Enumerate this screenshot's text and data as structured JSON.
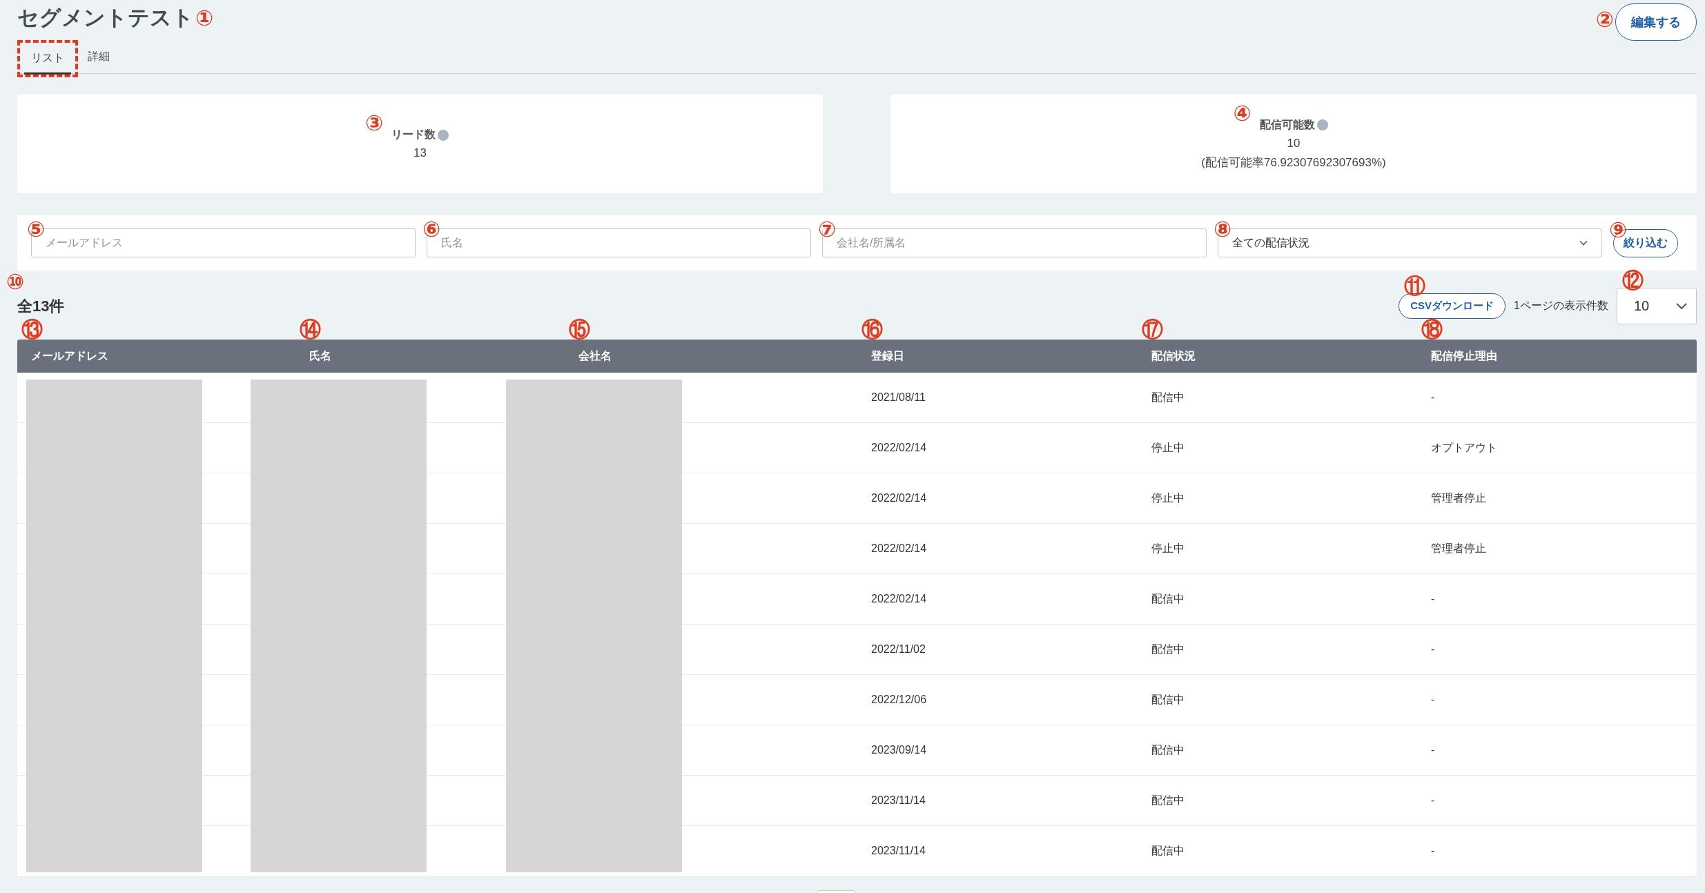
{
  "header": {
    "title": "セグメントテスト",
    "title_callout": "①",
    "edit_button": {
      "label": "編集する",
      "callout": "②"
    }
  },
  "tabs": [
    {
      "label": "リスト",
      "selected": true,
      "highlighted": true
    },
    {
      "label": "詳細",
      "selected": false,
      "highlighted": false
    }
  ],
  "stats": [
    {
      "label": "リード数",
      "value": "13",
      "callout": "③"
    },
    {
      "label": "配信可能数",
      "value": "10",
      "note": "(配信可能率76.92307692307693%)",
      "callout": "④"
    }
  ],
  "filters": {
    "fields": [
      {
        "kind": "text",
        "placeholder": "メールアドレス",
        "callout": "⑤"
      },
      {
        "kind": "text",
        "placeholder": "氏名",
        "callout": "⑥"
      },
      {
        "kind": "text",
        "placeholder": "会社名/所属名",
        "callout": "⑦"
      },
      {
        "kind": "select",
        "value": "全ての配信状況",
        "callout": "⑧"
      }
    ],
    "button": {
      "label": "絞り込む",
      "callout": "⑨"
    }
  },
  "results": {
    "total": "全13件",
    "total_callout": "⑩",
    "csv_button": {
      "label": "CSVダウンロード",
      "callout": "⑪"
    },
    "per_page_label": "1ページの表示件数",
    "per_page": {
      "value": "10",
      "callout": "⑫"
    }
  },
  "table": {
    "columns": [
      {
        "label": "メールアドレス",
        "callout": "⑬",
        "redacted": true
      },
      {
        "label": "氏名",
        "callout": "⑭",
        "redacted": true
      },
      {
        "label": "会社名",
        "callout": "⑮",
        "redacted": true
      },
      {
        "label": "登録日",
        "callout": "⑯",
        "redacted": false
      },
      {
        "label": "配信状況",
        "callout": "⑰",
        "redacted": false
      },
      {
        "label": "配信停止理由",
        "callout": "⑱",
        "redacted": false
      }
    ],
    "rows": [
      {
        "cells": [
          "2021/08/11",
          "配信中",
          "-"
        ]
      },
      {
        "cells": [
          "2022/02/14",
          "停止中",
          "オプトアウト"
        ]
      },
      {
        "cells": [
          "2022/02/14",
          "停止中",
          "管理者停止"
        ]
      },
      {
        "cells": [
          "2022/02/14",
          "停止中",
          "管理者停止"
        ]
      },
      {
        "cells": [
          "2022/02/14",
          "配信中",
          "-"
        ]
      },
      {
        "cells": [
          "2022/11/02",
          "配信中",
          "-"
        ]
      },
      {
        "cells": [
          "2022/12/06",
          "配信中",
          "-"
        ]
      },
      {
        "cells": [
          "2023/09/14",
          "配信中",
          "-"
        ]
      },
      {
        "cells": [
          "2023/11/14",
          "配信中",
          "-"
        ]
      },
      {
        "cells": [
          "2023/11/14",
          "配信中",
          "-"
        ]
      }
    ]
  }
}
